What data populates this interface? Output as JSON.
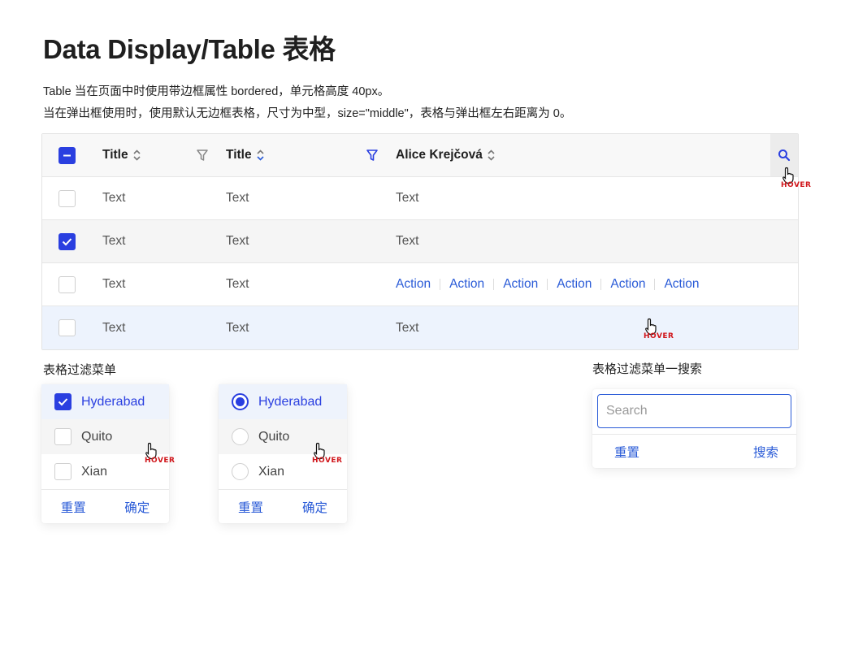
{
  "page": {
    "title": "Data Display/Table 表格",
    "desc_line1": "Table 当在页面中时使用带边框属性 bordered，单元格高度 40px。",
    "desc_line2": "当在弹出框使用时，使用默认无边框表格，尺寸为中型，size=\"middle\"，表格与弹出框左右距离为 0。"
  },
  "colors": {
    "primary": "#2a3fe0",
    "link": "#2a5bd7",
    "hover_label": "#d0161b",
    "row_hover_bg": "#edf3fd"
  },
  "table": {
    "headers": [
      "Title",
      "Title",
      "Alice Krejčová"
    ],
    "header_icons": [
      "minus-checkbox-icon",
      "sort-icon",
      "filter-icon",
      "sort-icon",
      "filter-active-icon",
      "sort-icon",
      "search-icon"
    ],
    "rows": [
      {
        "checked": false,
        "cells": [
          "Text",
          "Text",
          "Text"
        ]
      },
      {
        "checked": true,
        "cells": [
          "Text",
          "Text",
          "Text"
        ]
      },
      {
        "checked": false,
        "cells": [
          "Text",
          "Text"
        ],
        "actions": [
          "Action",
          "Action",
          "Action",
          "Action",
          "Action",
          "Action"
        ]
      },
      {
        "checked": false,
        "cells": [
          "Text",
          "Text",
          "Text"
        ]
      }
    ],
    "hover_label": "HOVER"
  },
  "filter_menu": {
    "label": "表格过滤菜单",
    "options": [
      "Hyderabad",
      "Quito",
      "Xian"
    ],
    "selected": "Hyderabad",
    "reset": "重置",
    "confirm": "确定",
    "hover_label": "HOVER"
  },
  "filter_search_menu": {
    "label": "表格过滤菜单一搜索",
    "placeholder": "Search",
    "reset": "重置",
    "search": "搜索"
  }
}
